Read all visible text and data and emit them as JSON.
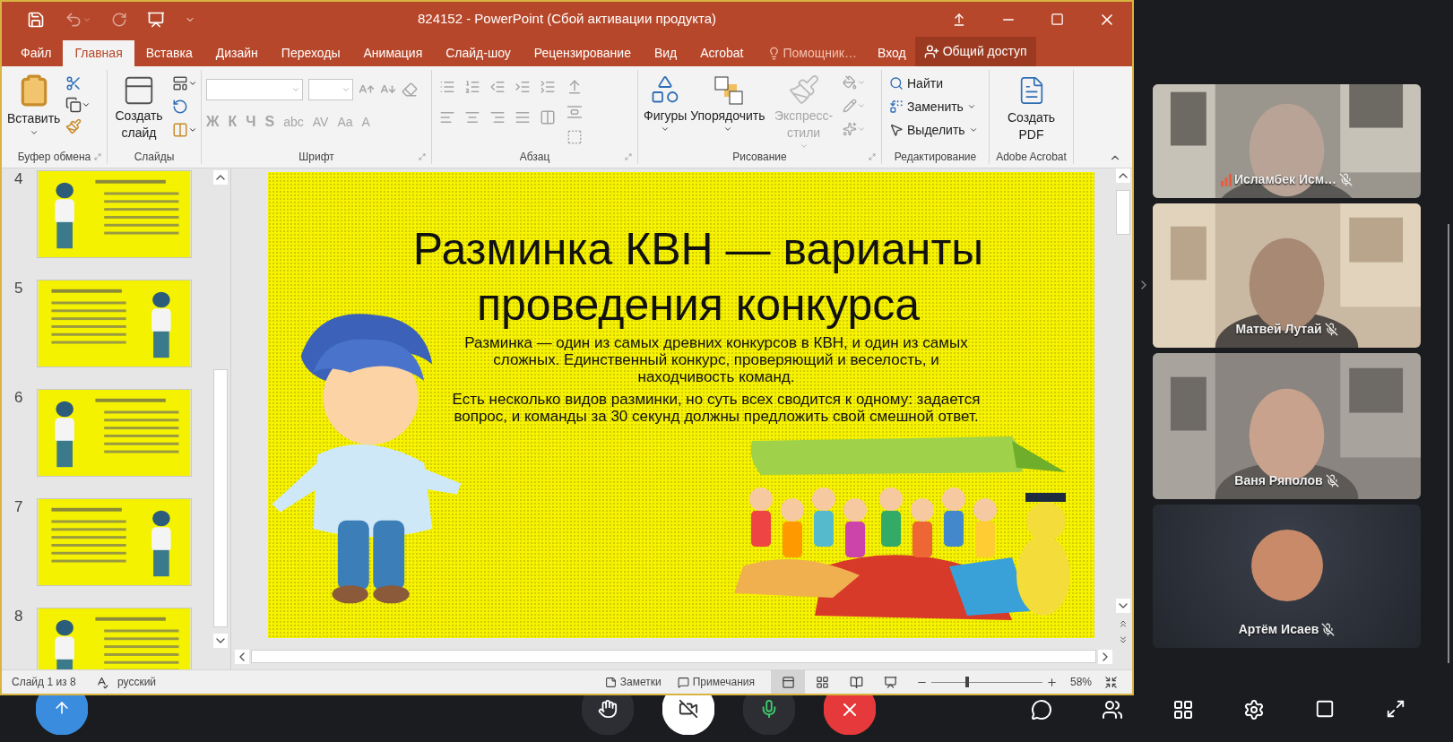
{
  "window": {
    "title": "824152 - PowerPoint (Сбой активации продукта)"
  },
  "tabs": [
    {
      "label": "Файл",
      "selected": false
    },
    {
      "label": "Главная",
      "selected": true
    },
    {
      "label": "Вставка",
      "selected": false
    },
    {
      "label": "Дизайн",
      "selected": false
    },
    {
      "label": "Переходы",
      "selected": false
    },
    {
      "label": "Анимация",
      "selected": false
    },
    {
      "label": "Слайд-шоу",
      "selected": false
    },
    {
      "label": "Рецензирование",
      "selected": false
    },
    {
      "label": "Вид",
      "selected": false
    },
    {
      "label": "Acrobat",
      "selected": false
    }
  ],
  "tell_me": "Помощник…",
  "sign_in": "Вход",
  "share": "Общий доступ",
  "ribbon": {
    "groups": [
      {
        "kind": "clipboard",
        "label": "Буфер обмена",
        "main": "Вставить"
      },
      {
        "kind": "slides",
        "label": "Слайды",
        "main": "Создать слайд"
      },
      {
        "kind": "font",
        "label": "Шрифт",
        "disabled": true,
        "buttons": [
          "Ж",
          "К",
          "Ч",
          "S",
          "abc",
          "AV",
          "Aa",
          "A"
        ]
      },
      {
        "kind": "paragraph",
        "label": "Абзац",
        "disabled": true
      },
      {
        "kind": "drawing",
        "label": "Рисование",
        "tools": [
          {
            "label": "Фигуры",
            "disabled": false
          },
          {
            "label": "Упорядочить",
            "disabled": false
          },
          {
            "label": "Экспресс-стили",
            "disabled": true
          }
        ]
      },
      {
        "kind": "editing",
        "label": "Редактирование",
        "items": [
          "Найти",
          "Заменить",
          "Выделить"
        ]
      },
      {
        "kind": "acrobat",
        "label": "Adobe Acrobat",
        "main": "Создать PDF"
      }
    ]
  },
  "slides_pane": {
    "thumbnails": [
      {
        "number": "4"
      },
      {
        "number": "5"
      },
      {
        "number": "6"
      },
      {
        "number": "7"
      },
      {
        "number": "8"
      }
    ]
  },
  "slide": {
    "title": "Разминка КВН — варианты проведения конкурса",
    "paragraphs": [
      "Разминка — один из самых древних конкурсов в КВН, и один из самых сложных. Единственный конкурс, проверяющий и веселость, и находчивость команд.",
      "Есть несколько видов разминки, но суть всех сводится к одному: задается вопрос, и команды за 30 секунд должны предложить свой смешной ответ."
    ]
  },
  "status_bar": {
    "slide": "Слайд 1 из 8",
    "language": "русский",
    "notes": "Заметки",
    "comments": "Примечания",
    "views": [
      {
        "kind": "normal",
        "selected": true
      },
      {
        "kind": "sorter",
        "selected": false
      },
      {
        "kind": "reading",
        "selected": false
      },
      {
        "kind": "slideshow",
        "selected": false
      }
    ],
    "zoom": {
      "level": 0.31,
      "reading": "58%"
    }
  },
  "participants": [
    {
      "kind": "video",
      "name": "Исламбек Исм…",
      "speaking": true,
      "muted": true
    },
    {
      "kind": "video",
      "name": "Матвей Лутай",
      "speaking": false,
      "muted": true
    },
    {
      "kind": "video",
      "name": "Ваня Ряполов",
      "speaking": false,
      "muted": true
    },
    {
      "kind": "avatar",
      "name": "Артём Исаев",
      "speaking": false,
      "muted": true
    }
  ],
  "call_controls": [
    {
      "kind": "share"
    },
    {
      "kind": "hand"
    },
    {
      "kind": "camera"
    },
    {
      "kind": "mic"
    },
    {
      "kind": "leave"
    },
    {
      "kind": "chat"
    },
    {
      "kind": "people"
    },
    {
      "kind": "grid"
    },
    {
      "kind": "settings"
    },
    {
      "kind": "layout"
    },
    {
      "kind": "fullscreen"
    }
  ]
}
